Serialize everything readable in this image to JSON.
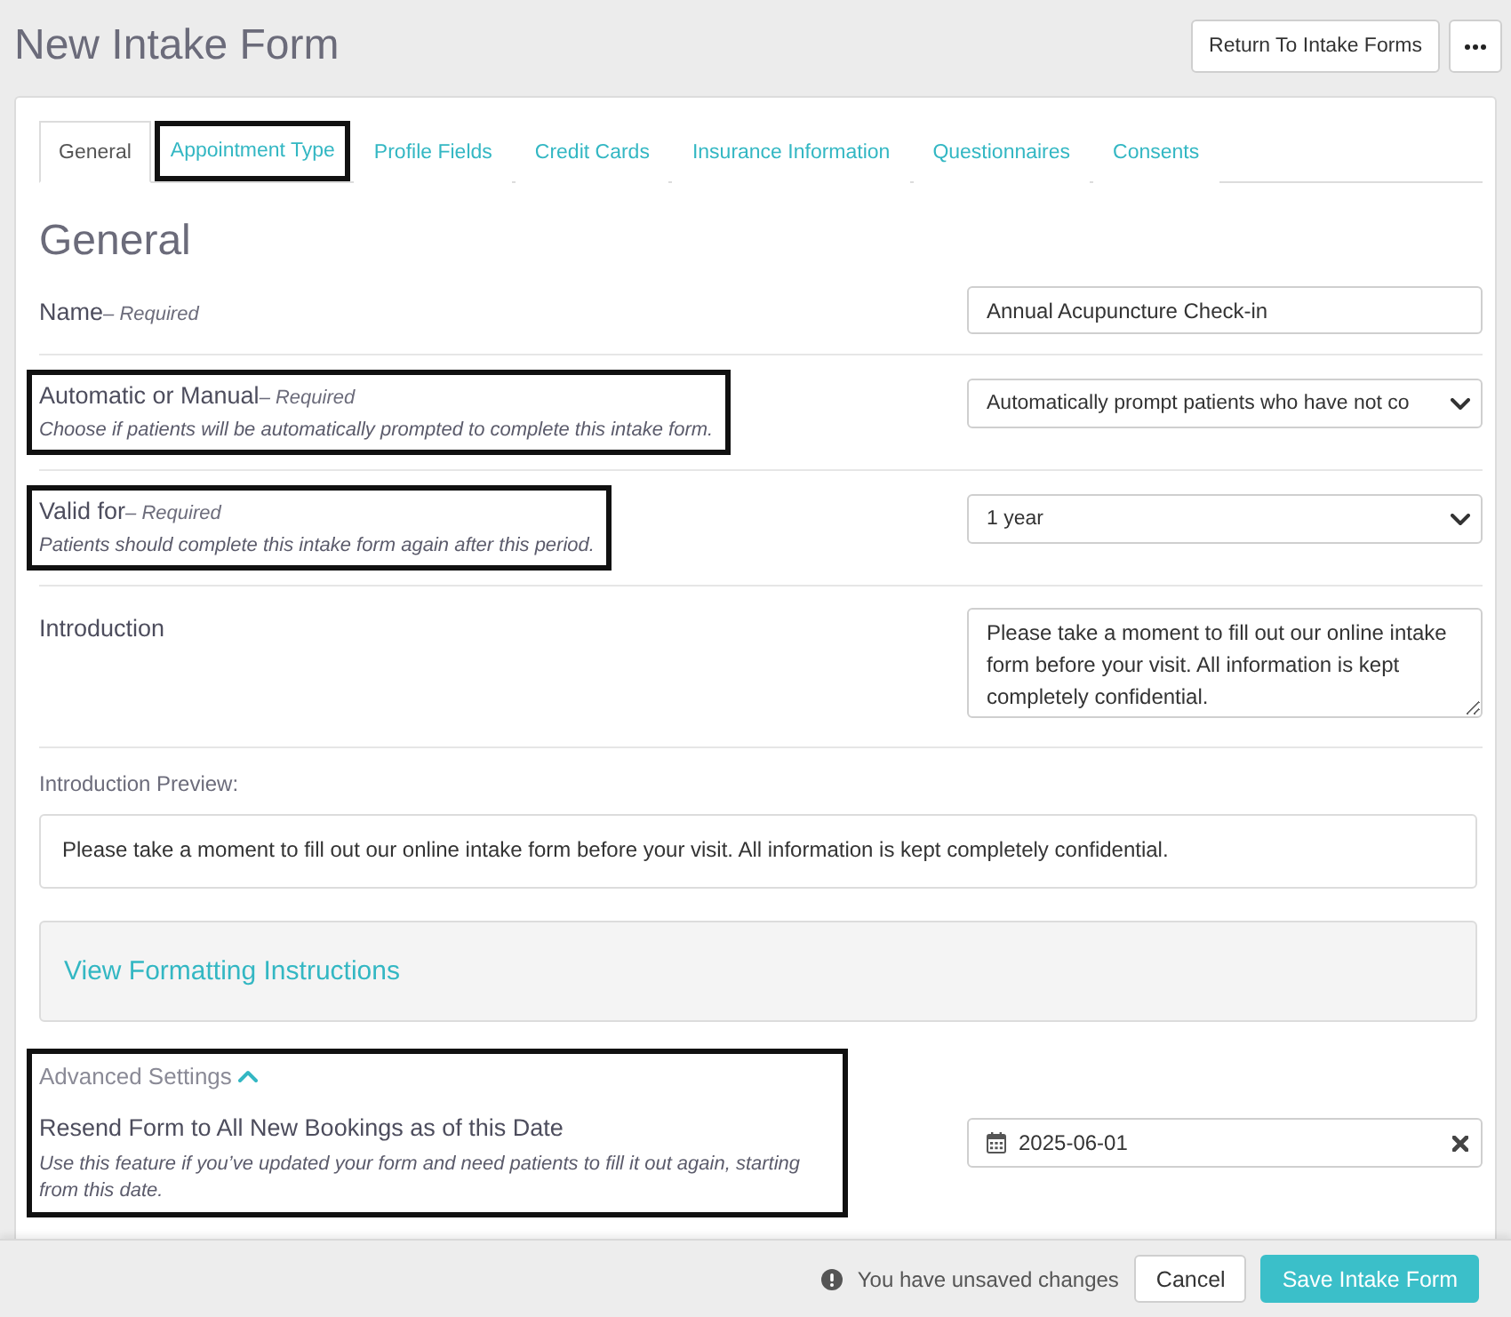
{
  "page": {
    "title": "New Intake Form",
    "return_button": "Return To Intake Forms"
  },
  "tabs": [
    {
      "label": "General",
      "selected": true,
      "highlighted": false
    },
    {
      "label": "Appointment Type",
      "selected": false,
      "highlighted": true
    },
    {
      "label": "Profile Fields",
      "selected": false,
      "highlighted": false
    },
    {
      "label": "Credit Cards",
      "selected": false,
      "highlighted": false
    },
    {
      "label": "Insurance Information",
      "selected": false,
      "highlighted": false
    },
    {
      "label": "Questionnaires",
      "selected": false,
      "highlighted": false
    },
    {
      "label": "Consents",
      "selected": false,
      "highlighted": false
    }
  ],
  "section_title": "General",
  "fields": [
    {
      "kind": "text",
      "label": "Name",
      "note": "– Required",
      "value": "Annual Acupuncture Check-in",
      "highlighted": false
    },
    {
      "kind": "select",
      "label": "Automatic or Manual",
      "note": "– Required",
      "help": "Choose if patients will be automatically prompted to complete this intake form.",
      "value": "Automatically prompt patients who have not co",
      "highlighted": true
    },
    {
      "kind": "select",
      "label": "Valid for",
      "note": "– Required",
      "help": "Patients should complete this intake form again after this period.",
      "value": "1 year",
      "highlighted": true
    },
    {
      "kind": "textarea",
      "label": "Introduction",
      "value": "Please take a moment to fill out our online intake form before your visit. All information is kept completely confidential.",
      "highlighted": false
    }
  ],
  "preview": {
    "label": "Introduction Preview:",
    "text": "Please take a moment to fill out our online intake form before your visit. All information is kept completely confidential."
  },
  "formatting": {
    "link": "View Formatting Instructions"
  },
  "advanced": {
    "toggle": "Advanced Settings",
    "expanded": true,
    "highlighted": true,
    "label": "Resend Form to All New Bookings as of this Date",
    "help": "Use this feature if you’ve updated your form and need patients to fill it out again, starting from this date.",
    "value": "2025-06-01"
  },
  "footer": {
    "notice": "You have unsaved changes",
    "buttons": [
      {
        "kind": "secondary",
        "label": "Cancel"
      },
      {
        "kind": "primary",
        "label": "Save Intake Form"
      }
    ]
  }
}
